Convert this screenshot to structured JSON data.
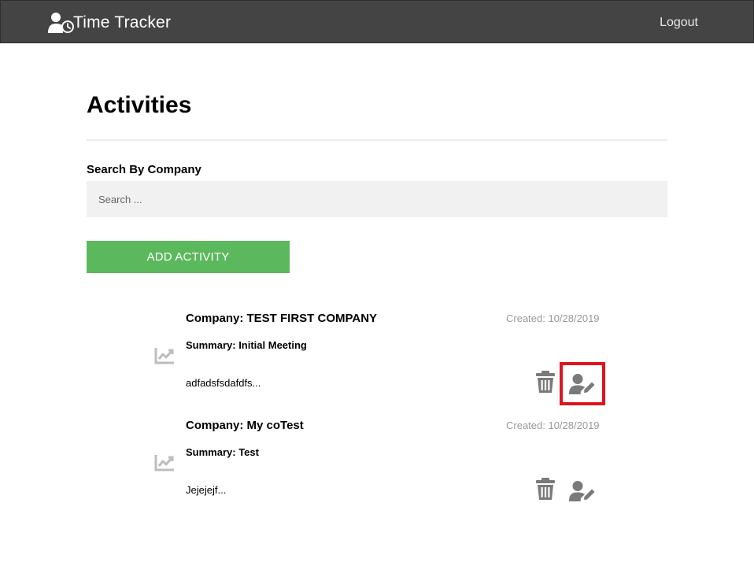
{
  "header": {
    "brand": "Time Tracker",
    "logout_label": "Logout",
    "brand_icon": "user-clock-icon"
  },
  "main": {
    "title": "Activities",
    "search_label": "Search By Company",
    "search_placeholder": "Search ...",
    "search_value": "",
    "add_button_label": "ADD ACTIVITY"
  },
  "activities": [
    {
      "company": "Company: TEST FIRST COMPANY",
      "created": "Created: 10/28/2019",
      "summary": "Summary: Initial Meeting",
      "description": "adfadsfsdafdfs...",
      "icon": "chart-line-icon",
      "edit_highlighted": true
    },
    {
      "company": "Company: My coTest",
      "created": "Created: 10/28/2019",
      "summary": "Summary: Test",
      "description": "Jejejejf...",
      "icon": "chart-line-icon",
      "edit_highlighted": false
    }
  ],
  "colors": {
    "navbar": "#444444",
    "add_button": "#5cb85c",
    "highlight": "#e0141e",
    "icon_gray": "#7a7a7a"
  }
}
